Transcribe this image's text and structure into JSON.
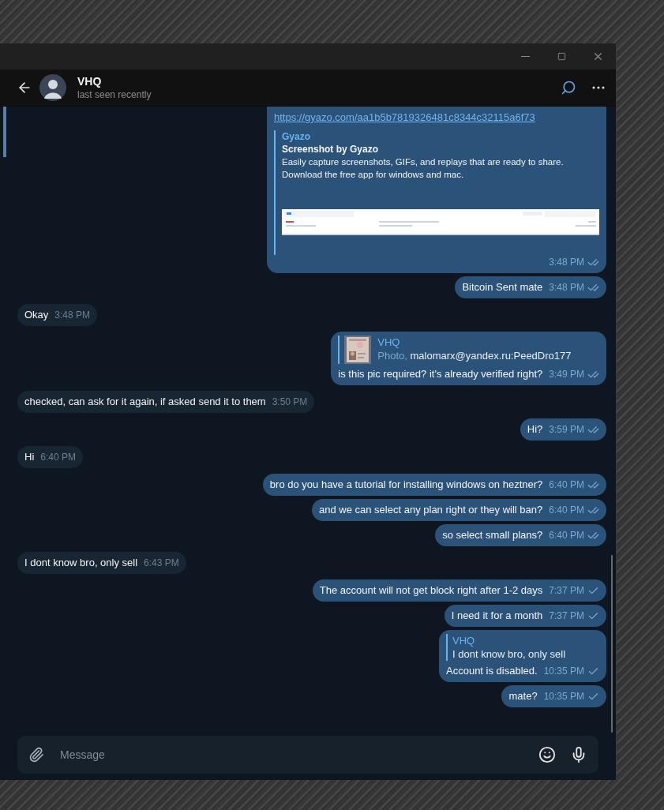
{
  "header": {
    "name": "VHQ",
    "status": "last seen recently"
  },
  "messages": [
    {
      "kind": "out",
      "link": "https://gyazo.com/aa1b5b7819326481c8344c32115a6f73",
      "preview": {
        "site": "Gyazo",
        "title": "Screenshot by Gyazo",
        "description_lines": [
          "Easily capture screenshots, GIFs, and replays that are ready to share.",
          "Download the free app for windows and mac."
        ]
      },
      "time": "3:48 PM",
      "read": true
    },
    {
      "kind": "out",
      "text": "Bitcoin Sent mate",
      "time": "3:48 PM",
      "read": true
    },
    {
      "kind": "in",
      "text": "Okay",
      "time": "3:48 PM"
    },
    {
      "kind": "out",
      "reply": {
        "author": "VHQ",
        "media_label": "Photo,",
        "text": "malomarx@yandex.ru:PeedDro177"
      },
      "text": "is this pic required? it's already verified right?",
      "time": "3:49 PM",
      "read": true
    },
    {
      "kind": "in",
      "text": "checked, can ask for it again, if asked send it to them",
      "time": "3:50 PM"
    },
    {
      "kind": "out",
      "text": "Hi?",
      "time": "3:59 PM",
      "read": true
    },
    {
      "kind": "in",
      "text": "Hi",
      "time": "6:40 PM"
    },
    {
      "kind": "out",
      "text": "bro do you have a tutorial for installing windows on heztner?",
      "time": "6:40 PM",
      "read": true
    },
    {
      "kind": "out",
      "text": "and we can select any plan right or they will ban?",
      "time": "6:40 PM",
      "read": true
    },
    {
      "kind": "out",
      "text": "so select small plans?",
      "time": "6:40 PM",
      "read": true
    },
    {
      "kind": "in",
      "text": "I dont know bro, only sell",
      "time": "6:43 PM"
    },
    {
      "kind": "out",
      "text": "The account will not get block right after 1-2 days",
      "time": "7:37 PM",
      "read": false
    },
    {
      "kind": "out",
      "text": "I need it for a month",
      "time": "7:37 PM",
      "read": false
    },
    {
      "kind": "out",
      "reply": {
        "author": "VHQ",
        "text": "I dont know bro, only sell"
      },
      "text": "Account is disabled.",
      "time": "10:35 PM",
      "read": false
    },
    {
      "kind": "out",
      "text": "mate?",
      "time": "10:35 PM",
      "read": false
    }
  ],
  "composer": {
    "placeholder": "Message"
  }
}
